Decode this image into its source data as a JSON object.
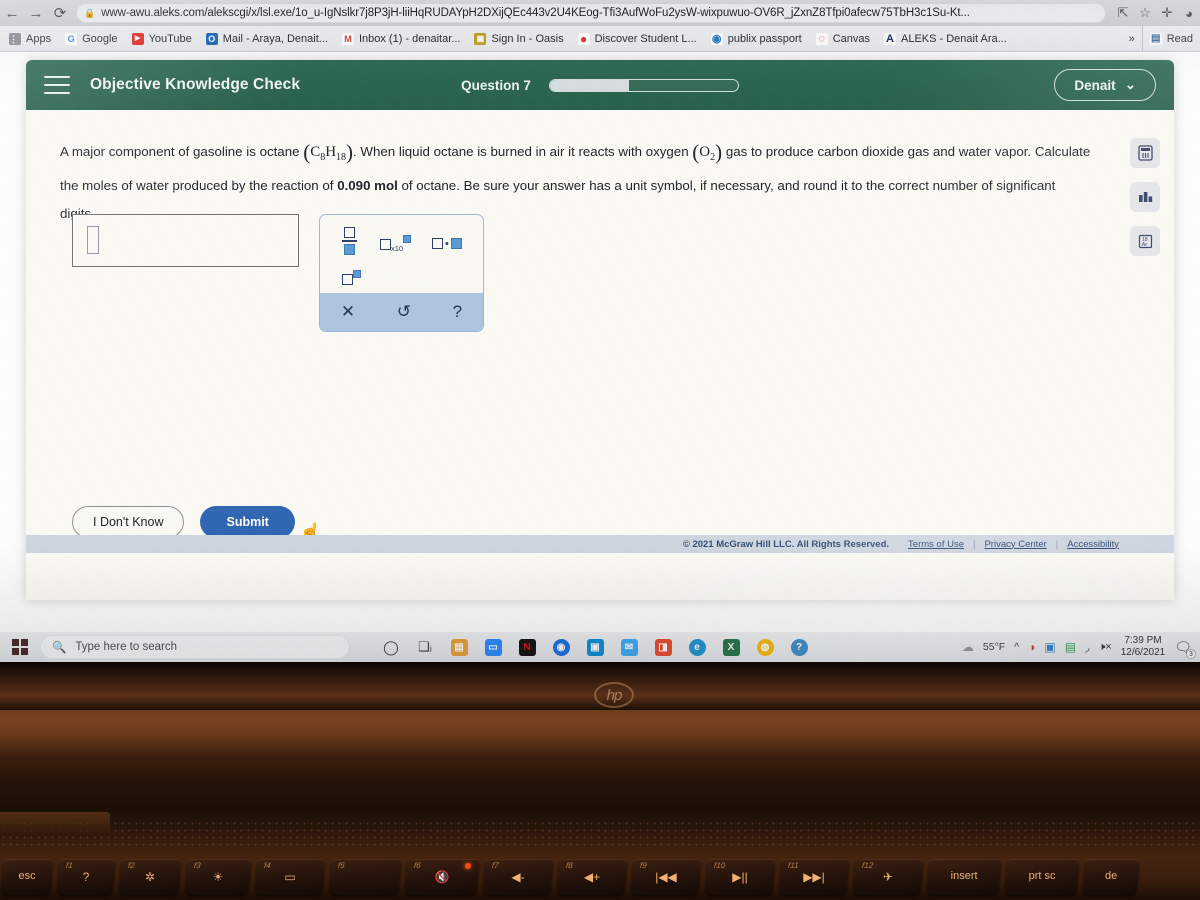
{
  "browser": {
    "nav": {
      "back": "←",
      "forward": "→",
      "reload": "⟳"
    },
    "lock_icon": "lock-icon",
    "url": "www-awu.aleks.com/alekscgi/x/lsl.exe/1o_u-IgNslkr7j8P3jH-liiHqRUDAYpH2DXijQEc443v2U4KEog-Tfi3AufWoFu2ysW-wixpuwuo-OV6R_jZxnZ8Tfpi0afecw75TbH3c1Su-Kt...",
    "share_icon": "share-icon",
    "star_icon": "bookmark-star-icon",
    "extensions_icon": "puzzle-extensions-icon",
    "profile_icon": "profile-avatar-icon",
    "bookmarks": [
      {
        "label": "Apps",
        "icon": "apps-grid-icon",
        "color": "#8a8f96",
        "glyph": ""
      },
      {
        "label": "Google",
        "icon": "google-icon",
        "color": "#ffffff",
        "glyph": "G"
      },
      {
        "label": "YouTube",
        "icon": "youtube-icon",
        "color": "#e52d27",
        "glyph": "▶"
      },
      {
        "label": "Mail - Araya, Denait...",
        "icon": "outlook-mail-icon",
        "color": "#1b66b5",
        "glyph": "O"
      },
      {
        "label": "Inbox (1) - denaitar...",
        "icon": "gmail-icon",
        "color": "#ffffff",
        "glyph": "M"
      },
      {
        "label": "Sign In - Oasis",
        "icon": "oasis-icon",
        "color": "#c2a22a",
        "glyph": "▦"
      },
      {
        "label": "Discover Student L...",
        "icon": "discover-icon",
        "color": "#d93a2b",
        "glyph": "●"
      },
      {
        "label": "publix passport",
        "icon": "publix-icon",
        "color": "#2f7fc4",
        "glyph": "◉"
      },
      {
        "label": "Canvas",
        "icon": "canvas-icon",
        "color": "#ffffff",
        "glyph": "◌"
      },
      {
        "label": "ALEKS - Denait Ara...",
        "icon": "aleks-icon",
        "color": "#ffffff",
        "glyph": "A"
      }
    ],
    "overflow_label": "»",
    "reading_list_label": "Read",
    "reading_list_icon": "reading-list-icon"
  },
  "aleks": {
    "menu_icon": "hamburger-menu-icon",
    "title": "Objective Knowledge Check",
    "question_label": "Question 7",
    "progress_percent": 42,
    "user_name": "Denait",
    "user_chevron": "chevron-down-icon",
    "question": {
      "line1_a": "A major component of gasoline is octane ",
      "formula_octane": "C8H18",
      "line1_b": ". When liquid octane is burned in air it reacts with oxygen ",
      "formula_oxygen": "O2",
      "line1_c": " gas to produce carbon dioxide gas and water vapor. Calculate the moles of water produced by the reaction of ",
      "amount": "0.090 mol",
      "line1_d": " of octane. Be sure your answer has a unit symbol, if necessary, and round it to the correct number of significant digits."
    },
    "answer_input_value": "",
    "answer_input_placeholder": "",
    "math_palette": {
      "fraction": "fraction-template",
      "scientific": "times-ten-power-template",
      "multiply": "box-dot-box-template",
      "superscript": "box-superscript-template",
      "x10_label": "x10",
      "clear": "✕",
      "undo": "↺",
      "help": "?"
    },
    "tools": [
      {
        "name": "calculator-icon",
        "glyph": "▤"
      },
      {
        "name": "data-chart-icon",
        "glyph": "▮▮"
      },
      {
        "name": "periodic-table-icon",
        "glyph": "⚛"
      }
    ],
    "buttons": {
      "dont_know": "I Don't Know",
      "submit": "Submit"
    },
    "footer": {
      "copyright": "© 2021 McGraw Hill LLC. All Rights Reserved.",
      "links": [
        "Terms of Use",
        "Privacy Center",
        "Accessibility"
      ],
      "separator": "|"
    },
    "accent_green": "#2a6450",
    "accent_blue": "#2f66b3"
  },
  "taskbar": {
    "start_icon": "windows-start-icon",
    "search_placeholder": "Type here to search",
    "search_icon": "search-icon",
    "apps": [
      {
        "name": "cortana-icon",
        "glyph": "◯",
        "color": "transparent",
        "fg": "#3a3e44"
      },
      {
        "name": "task-view-icon",
        "glyph": "❐",
        "color": "transparent",
        "fg": "#3a3e44"
      },
      {
        "name": "file-explorer-icon",
        "glyph": "🗀",
        "color": "#e8a33d",
        "fg": "#fff"
      },
      {
        "name": "zoom-icon",
        "glyph": "▭",
        "color": "#2d8cff",
        "fg": "#fff"
      },
      {
        "name": "netflix-icon",
        "glyph": "N",
        "color": "#141414",
        "fg": "#e50914"
      },
      {
        "name": "chrome-canary-icon",
        "glyph": "◉",
        "color": "#1a73e8",
        "fg": "#fff"
      },
      {
        "name": "store-icon",
        "glyph": "▣",
        "color": "#0f8fd8",
        "fg": "#fff"
      },
      {
        "name": "mail-icon",
        "glyph": "✉",
        "color": "#3fa9f5",
        "fg": "#fff"
      },
      {
        "name": "office-icon",
        "glyph": "◨",
        "color": "#e8492b",
        "fg": "#fff"
      },
      {
        "name": "edge-icon",
        "glyph": "e",
        "color": "#1b8fd1",
        "fg": "#fff"
      },
      {
        "name": "excel-icon",
        "glyph": "X",
        "color": "#1d6f42",
        "fg": "#fff"
      },
      {
        "name": "chrome-icon",
        "glyph": "◍",
        "color": "#f4b400",
        "fg": "#fff"
      },
      {
        "name": "help-icon",
        "glyph": "?",
        "color": "#2f86c5",
        "fg": "#fff"
      }
    ],
    "weather": "55°F",
    "weather_icon": "cloud-icon",
    "chevron": "^",
    "tray": [
      {
        "name": "antivirus-tray-icon",
        "glyph": "◑",
        "color": "#d03a3a"
      },
      {
        "name": "display-tray-icon",
        "glyph": "▣",
        "color": "#2f7fc4"
      },
      {
        "name": "battery-tray-icon",
        "glyph": "▤",
        "color": "#2d9d5a"
      },
      {
        "name": "wifi-tray-icon",
        "glyph": "◢",
        "color": "#3a3e44"
      },
      {
        "name": "volume-muted-tray-icon",
        "glyph": "🔇",
        "color": "#3a3e44"
      }
    ],
    "time": "7:39 PM",
    "date": "12/6/2021",
    "notification_icon": "notification-icon",
    "notification_count": "3"
  },
  "laptop": {
    "brand": "hp",
    "keys": [
      {
        "fn": "",
        "label": "esc",
        "glyph": "",
        "wide": true
      },
      {
        "fn": "f1",
        "label": "",
        "glyph": "?"
      },
      {
        "fn": "f2",
        "label": "",
        "glyph": "✲"
      },
      {
        "fn": "f3",
        "label": "",
        "glyph": "☀"
      },
      {
        "fn": "f4",
        "label": "",
        "glyph": "▭"
      },
      {
        "fn": "f5",
        "label": "",
        "glyph": ""
      },
      {
        "fn": "f6",
        "label": "",
        "glyph": "🔇",
        "led": true
      },
      {
        "fn": "f7",
        "label": "",
        "glyph": "◀-"
      },
      {
        "fn": "f8",
        "label": "",
        "glyph": "◀+"
      },
      {
        "fn": "f9",
        "label": "",
        "glyph": "|◀◀"
      },
      {
        "fn": "f10",
        "label": "",
        "glyph": "▶||"
      },
      {
        "fn": "f11",
        "label": "",
        "glyph": "▶▶|"
      },
      {
        "fn": "f12",
        "label": "",
        "glyph": "✈"
      },
      {
        "fn": "",
        "label": "insert",
        "glyph": "",
        "wide": true
      },
      {
        "fn": "",
        "label": "prt sc",
        "glyph": "",
        "wide": true
      },
      {
        "fn": "",
        "label": "de",
        "glyph": "",
        "wide": true
      }
    ]
  }
}
